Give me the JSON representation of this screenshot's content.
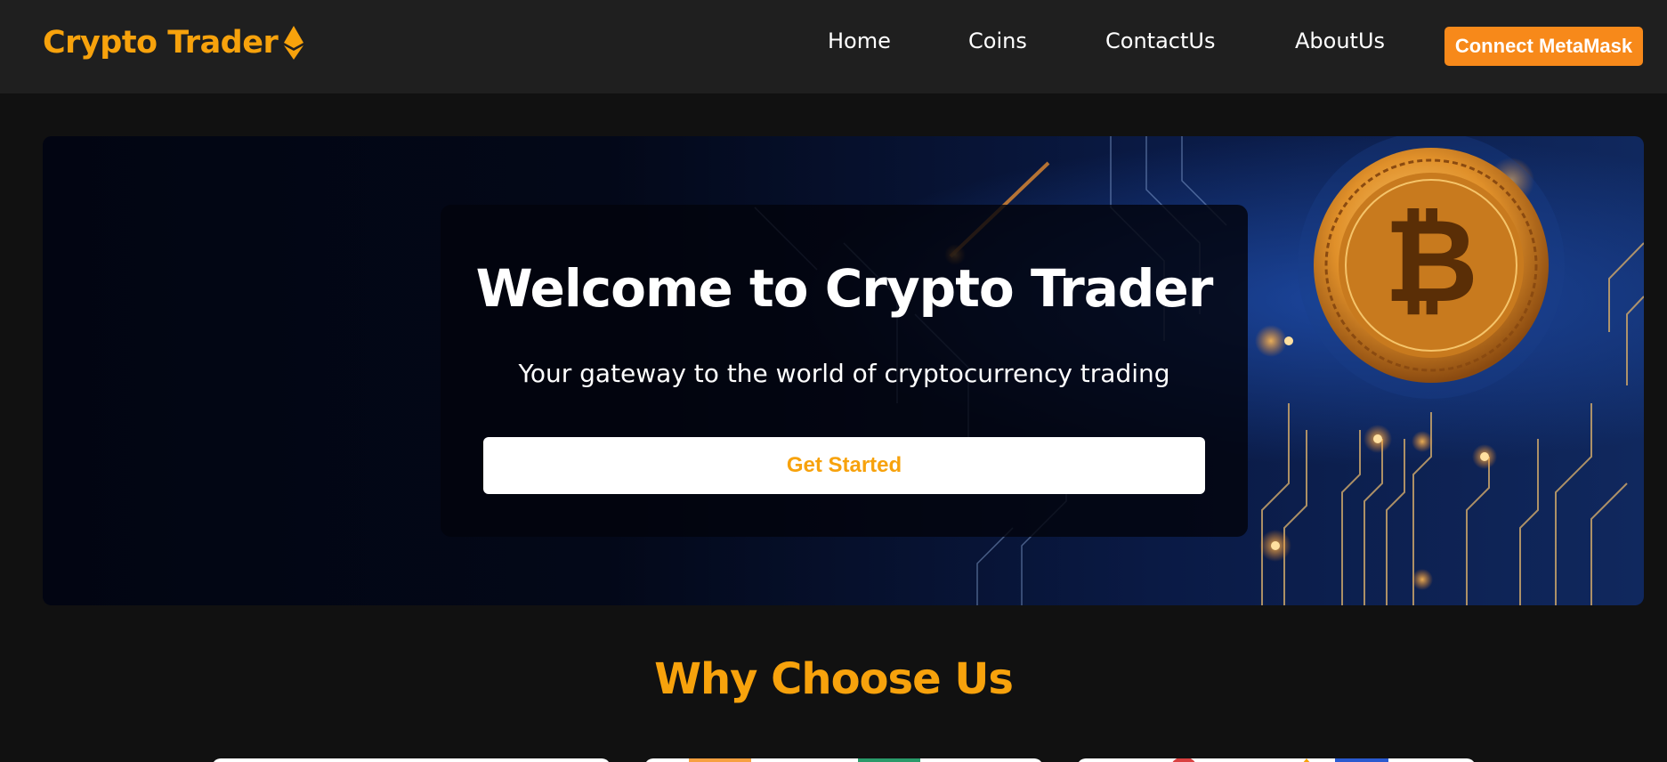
{
  "brand": {
    "name": "Crypto Trader",
    "icon": "ethereum-icon",
    "color": "#f7a20c"
  },
  "nav": {
    "links": [
      {
        "label": "Home"
      },
      {
        "label": "Coins"
      },
      {
        "label": "ContactUs"
      },
      {
        "label": "AboutUs"
      }
    ],
    "connect_label": "Connect MetaMask",
    "connect_color": "#f7891a"
  },
  "hero": {
    "title": "Welcome to Crypto Trader",
    "subtitle": "Your gateway to the world of cryptocurrency trading",
    "cta_label": "Get Started",
    "image": "bitcoin-circuit-board-image"
  },
  "features": {
    "title": "Why Choose Us"
  },
  "colors": {
    "background": "#111111",
    "navbar": "#1f1f1f",
    "accent": "#f7a20c"
  }
}
